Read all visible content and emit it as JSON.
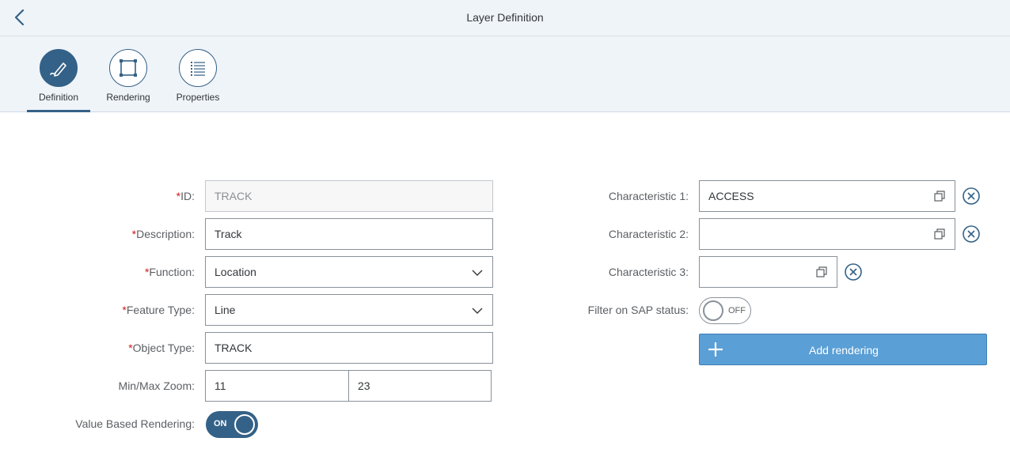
{
  "header": {
    "title": "Layer Definition",
    "back_icon": "chevron-left-icon"
  },
  "tabs": [
    {
      "label": "Definition",
      "icon": "pencil-icon",
      "active": true
    },
    {
      "label": "Rendering",
      "icon": "selection-frame-icon",
      "active": false
    },
    {
      "label": "Properties",
      "icon": "list-icon",
      "active": false
    }
  ],
  "form": {
    "id": {
      "label": "ID:",
      "value": "TRACK",
      "required": true
    },
    "description": {
      "label": "Description:",
      "value": "Track",
      "required": true
    },
    "function": {
      "label": "Function:",
      "value": "Location",
      "required": true
    },
    "feature_type": {
      "label": "Feature Type:",
      "value": "Line",
      "required": true
    },
    "object_type": {
      "label": "Object Type:",
      "value": "TRACK",
      "required": true
    },
    "zoom": {
      "label": "Min/Max Zoom:",
      "min": "11",
      "max": "23"
    },
    "value_based": {
      "label": "Value Based Rendering:",
      "state": "ON"
    }
  },
  "characteristics": {
    "c1": {
      "label": "Characteristic 1:",
      "value": "ACCESS"
    },
    "c2": {
      "label": "Characteristic 2:",
      "value": ""
    },
    "c3": {
      "label": "Characteristic 3:",
      "value": ""
    },
    "filter": {
      "label": "Filter on SAP status:",
      "state": "OFF"
    },
    "add_rendering": "Add rendering"
  },
  "colors": {
    "accent": "#346187",
    "button": "#5a9fd6",
    "required": "#cc1919"
  }
}
